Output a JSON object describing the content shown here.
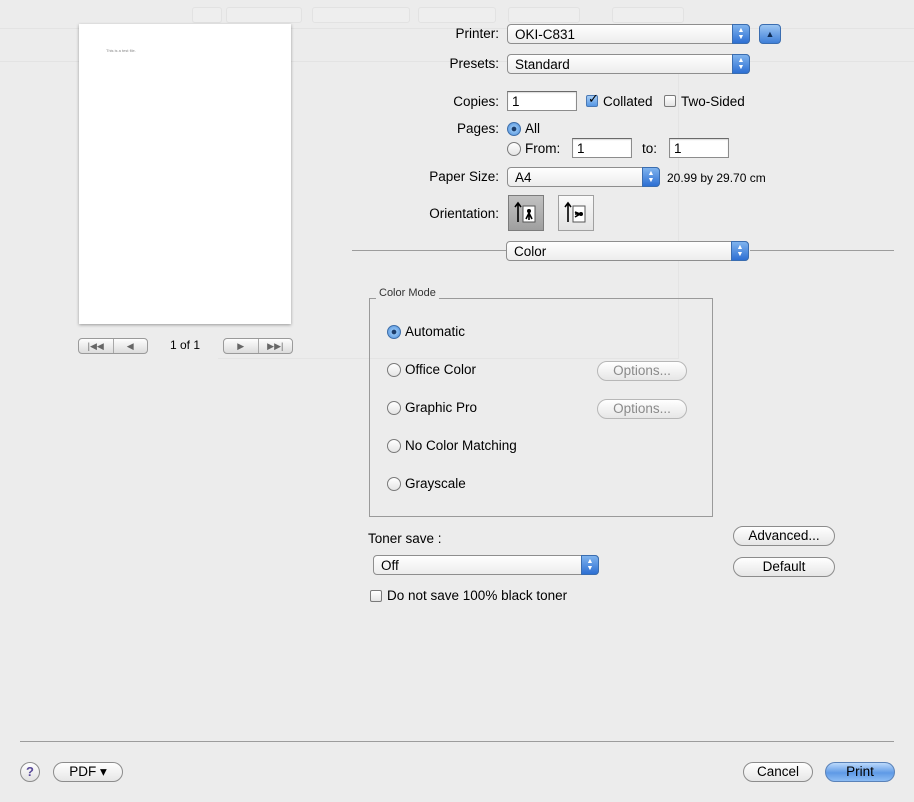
{
  "preview": {
    "page_text": "This is a test file.",
    "page_count": "1 of 1"
  },
  "printer": {
    "label": "Printer:",
    "value": "OKI-C831",
    "expand_icon": "disclosure-up-icon"
  },
  "presets": {
    "label": "Presets:",
    "value": "Standard"
  },
  "copies": {
    "label": "Copies:",
    "value": "1",
    "collated_label": "Collated",
    "collated_checked": true,
    "two_sided_label": "Two-Sided",
    "two_sided_checked": false
  },
  "pages": {
    "label": "Pages:",
    "all_label": "All",
    "from_label": "From:",
    "from_value": "1",
    "to_label": "to:",
    "to_value": "1",
    "selected": "All"
  },
  "paper_size": {
    "label": "Paper Size:",
    "value": "A4",
    "dimensions": "20.99 by 29.70 cm"
  },
  "orientation": {
    "label": "Orientation:",
    "selected": "portrait"
  },
  "panel_menu": {
    "value": "Color"
  },
  "color_mode": {
    "title": "Color Mode",
    "options": [
      {
        "label": "Automatic",
        "selected": true
      },
      {
        "label": "Office Color",
        "selected": false,
        "button": "Options..."
      },
      {
        "label": "Graphic Pro",
        "selected": false,
        "button": "Options..."
      },
      {
        "label": "No Color Matching",
        "selected": false
      },
      {
        "label": "Grayscale",
        "selected": false
      }
    ]
  },
  "toner_save": {
    "label": "Toner save :",
    "value": "Off",
    "black_label": "Do not save 100% black toner",
    "black_checked": false
  },
  "buttons": {
    "advanced": "Advanced...",
    "default": "Default",
    "pdf": "PDF ▾",
    "help": "?",
    "cancel": "Cancel",
    "print": "Print"
  },
  "colors": {
    "accent": "#4f8fdc",
    "background": "#ececec"
  }
}
